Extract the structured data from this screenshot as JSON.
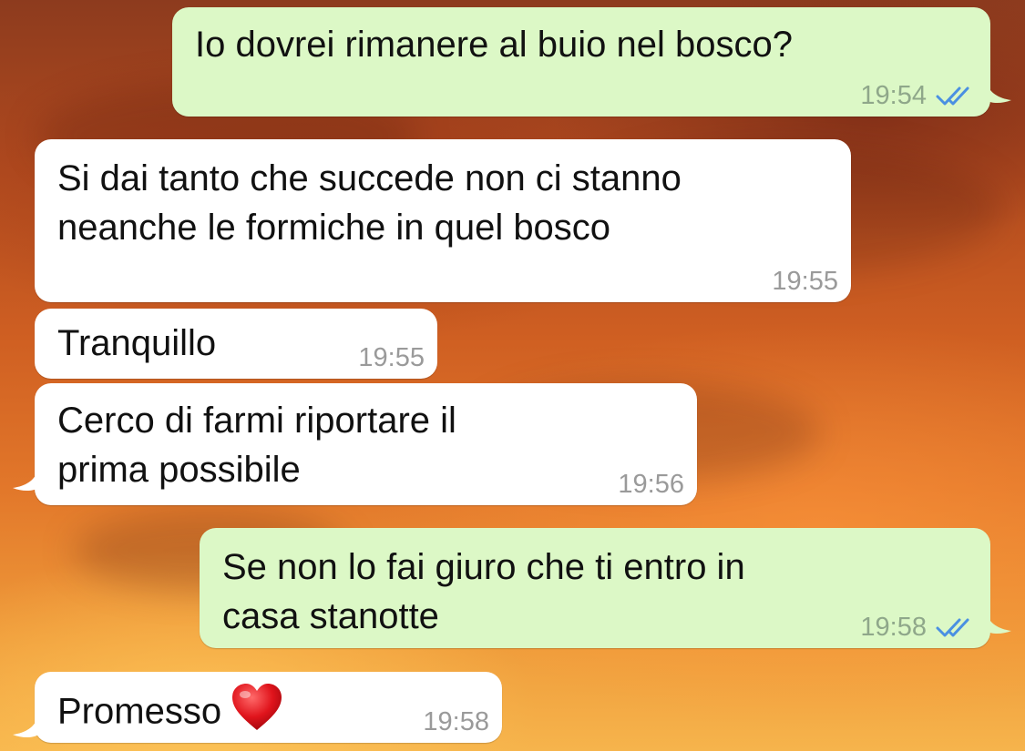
{
  "messages": [
    {
      "direction": "out",
      "text": "Io dovrei rimanere al buio nel bosco?",
      "time": "19:54",
      "status": "read"
    },
    {
      "direction": "in",
      "lines": [
        "Si dai tanto che succede non ci stanno",
        "neanche le formiche in quel bosco"
      ],
      "time": "19:55"
    },
    {
      "direction": "in",
      "text": "Tranquillo",
      "time": "19:55"
    },
    {
      "direction": "in",
      "lines": [
        "Cerco di farmi riportare il",
        "prima possibile"
      ],
      "time": "19:56"
    },
    {
      "direction": "out",
      "lines": [
        "Se non lo fai giuro che ti entro in",
        "casa stanotte"
      ],
      "time": "19:58",
      "status": "read"
    },
    {
      "direction": "in",
      "text": "Promesso",
      "emoji": "heart-emoji",
      "time": "19:58"
    }
  ],
  "colors": {
    "outgoing_bubble": "#dcf8c6",
    "incoming_bubble": "#ffffff",
    "read_ticks": "#4a90e2",
    "timestamp": "#9a9a9a"
  },
  "icons": {
    "read_receipt": "double-check-icon",
    "heart": "red-heart-emoji"
  }
}
